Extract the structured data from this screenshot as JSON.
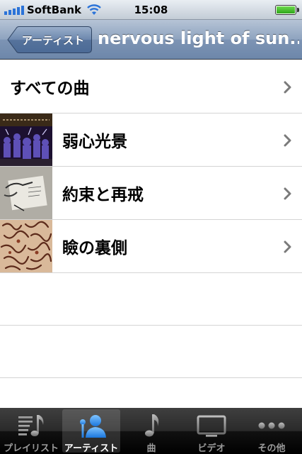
{
  "status_bar": {
    "carrier": "SoftBank",
    "time": "15:08",
    "battery_level": 1.0
  },
  "nav": {
    "back_label": "アーティスト",
    "title": "nervous light of sun..."
  },
  "list": {
    "all_songs_label": "すべての曲",
    "albums": [
      {
        "title": "弱心光景",
        "art_icon": "album-art-crowd"
      },
      {
        "title": "約束と再戒",
        "art_icon": "album-art-sketch"
      },
      {
        "title": "瞼の裏側",
        "art_icon": "album-art-pattern"
      }
    ]
  },
  "tab_bar": {
    "tabs": [
      {
        "label": "プレイリスト",
        "icon": "playlist-icon",
        "active": false
      },
      {
        "label": "アーティスト",
        "icon": "artist-icon",
        "active": true
      },
      {
        "label": "曲",
        "icon": "song-icon",
        "active": false
      },
      {
        "label": "ビデオ",
        "icon": "video-icon",
        "active": false
      },
      {
        "label": "その他",
        "icon": "more-icon",
        "active": false
      }
    ]
  },
  "colors": {
    "nav_bar": "#7d94b4",
    "active_tab_icon": "#2f8ff0",
    "signal": "#2b73d8",
    "battery": "#3bb227"
  }
}
